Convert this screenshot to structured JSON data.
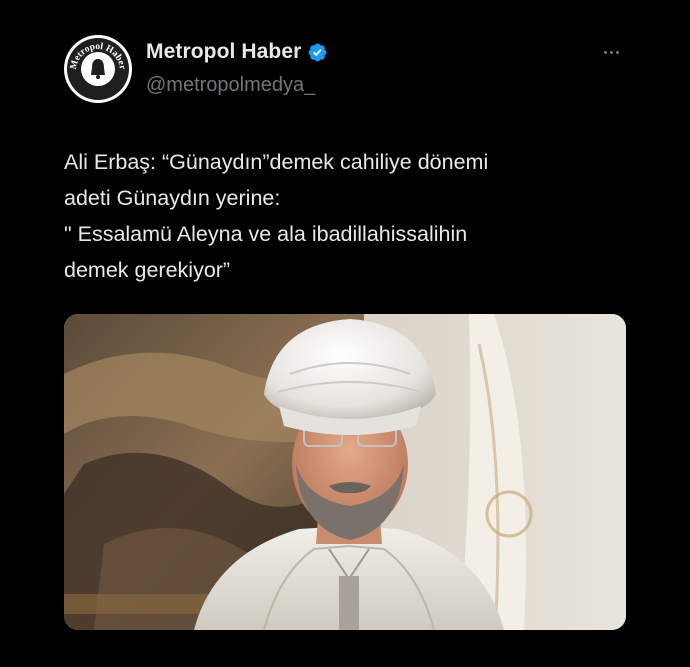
{
  "account": {
    "display_name": "Metropol Haber",
    "handle": "@metropolmedya_",
    "verified": true,
    "avatar_logo_text": "Metropol Haber",
    "verified_icon": "verified-badge-icon",
    "more_icon": "more-options-icon"
  },
  "tweet": {
    "lines": [
      "Ali Erbaş: “Günaydın”demek cahiliye dönemi",
      "adeti Günaydın yerine:",
      "\" Essalamü Aleyna ve ala ibadillahissalihin",
      "demek gerekiyor”"
    ]
  },
  "media": {
    "description_icon": "photo-portrait-image"
  },
  "colors": {
    "background": "#000000",
    "text": "#e7e9ea",
    "secondary": "#71767b",
    "verified": "#1d9bf0"
  }
}
